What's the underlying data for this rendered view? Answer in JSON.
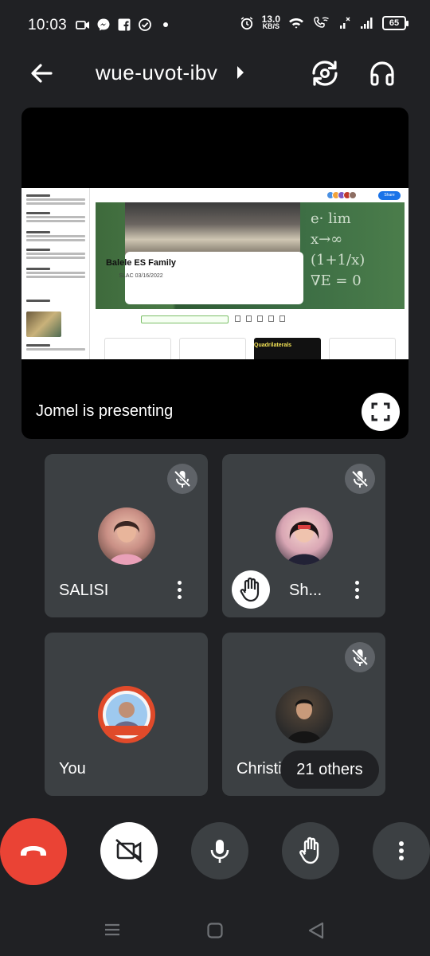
{
  "status_bar": {
    "time": "10:03",
    "net_speed_value": "13.0",
    "net_speed_unit": "KB/S",
    "battery": "65",
    "icons": [
      "video-icon",
      "messenger-icon",
      "facebook-icon",
      "check-circle-icon",
      "dot-icon",
      "alarm-icon",
      "wifi-icon",
      "wifi-calling-icon",
      "signal-x-icon",
      "signal-icon",
      "battery-icon"
    ]
  },
  "header": {
    "meeting_code": "wue-uvot-ibv",
    "icons": [
      "back-arrow-icon",
      "caret-right-icon",
      "switch-camera-icon",
      "headphones-icon"
    ]
  },
  "presentation": {
    "label": "Jomel is presenting",
    "screen": {
      "class_title": "Balele ES Family",
      "class_sub": "SLAC 03/16/2022",
      "card_label": "Quadrilaterals",
      "share_label": "Share"
    }
  },
  "participants": [
    {
      "name": "SALISI",
      "muted": true,
      "hand_raised": false,
      "avatar_color": "#c98f85"
    },
    {
      "name": "Sh...",
      "muted": true,
      "hand_raised": true,
      "avatar_color": "#d9a6b4"
    },
    {
      "name": "You",
      "muted": false,
      "hand_raised": false,
      "avatar_color": "#e04a2a",
      "badge": "Ambassador"
    },
    {
      "name": "Christia",
      "muted": true,
      "hand_raised": false,
      "avatar_color": "#2a2a2a"
    }
  ],
  "others_label": "21 others",
  "controls": {
    "end_call_color": "#ea4335",
    "icons": [
      "end-call-icon",
      "camera-off-icon",
      "microphone-icon",
      "raise-hand-icon",
      "more-vert-icon"
    ]
  },
  "navbar": {
    "icons": [
      "recents-icon",
      "home-icon",
      "back-triangle-icon"
    ]
  }
}
